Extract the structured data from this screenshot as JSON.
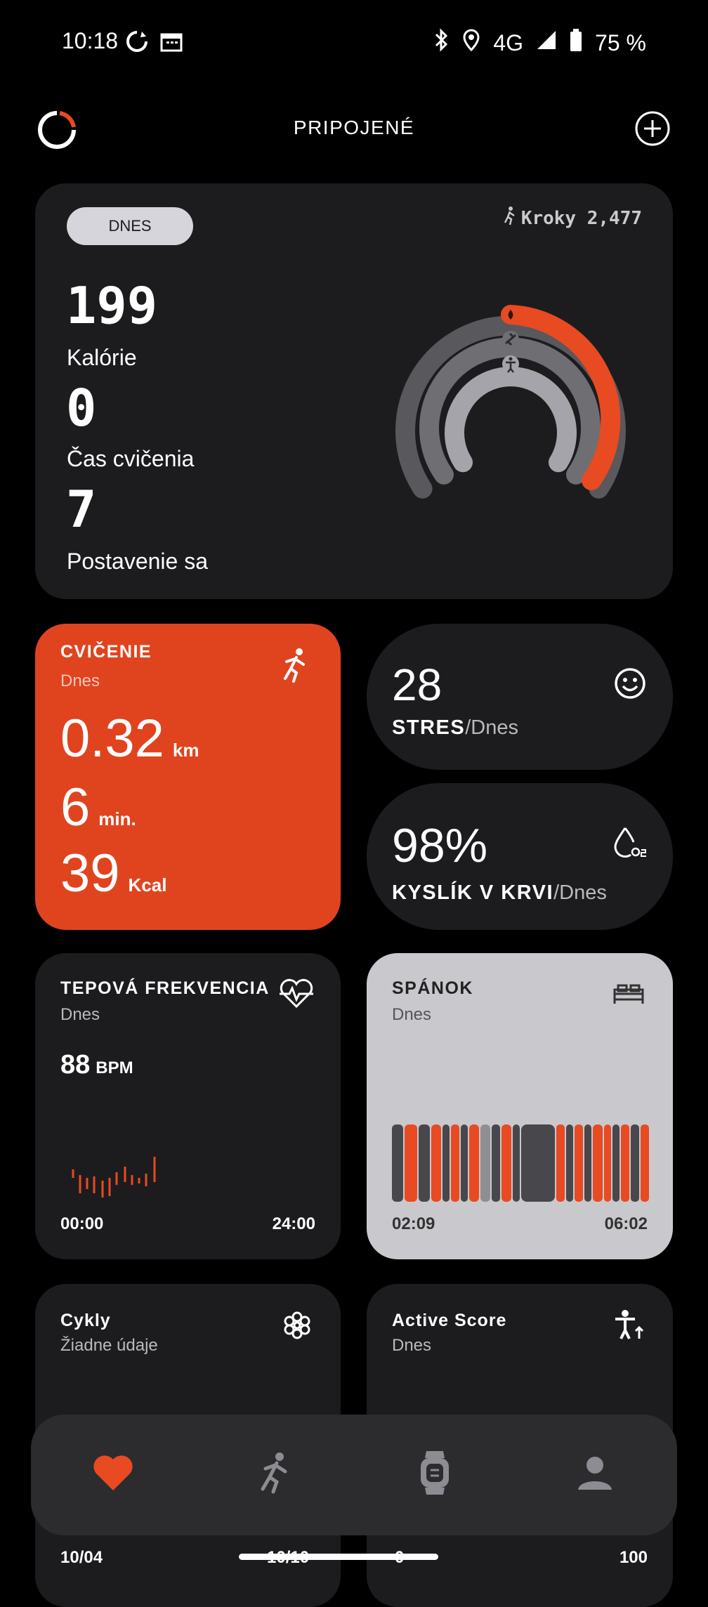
{
  "status_bar": {
    "time": "10:18",
    "network": "4G",
    "battery": "75 %",
    "icons": [
      "sync-icon",
      "calendar-icon",
      "bluetooth-icon",
      "location-icon",
      "signal-icon",
      "battery-icon"
    ]
  },
  "header": {
    "title": "PRIPOJENÉ"
  },
  "summary": {
    "tab": "DNES",
    "steps": "Kroky 2,477",
    "metrics": [
      {
        "value": "199",
        "label": "Kalórie"
      },
      {
        "value": "0",
        "label": "Čas cvičenia"
      },
      {
        "value": "7",
        "label": "Postavenie sa"
      }
    ],
    "rings": {
      "calories_fraction": 0.42,
      "exercise_fraction": 0.0,
      "stand_fraction": 0.0,
      "colors": {
        "accent": "#e84a22",
        "track_outer": "#59585d",
        "track_mid": "#6f6e73",
        "track_inner": "#a5a4aa"
      }
    }
  },
  "exercise": {
    "title": "CVIČENIE",
    "subtitle": "Dnes",
    "distance_value": "0.32",
    "distance_unit": "km",
    "time_value": "6",
    "time_unit": "min.",
    "kcal_value": "39",
    "kcal_unit": "Kcal",
    "color": "#e0441f"
  },
  "stress": {
    "value": "28",
    "label": "STRES",
    "suffix": "/Dnes"
  },
  "oxygen": {
    "value": "98%",
    "label": "KYSLÍK V KRVI",
    "suffix": "/Dnes"
  },
  "heart": {
    "title": "TEPOVÁ FREKVENCIA",
    "subtitle": "Dnes",
    "value": "88",
    "unit": "BPM",
    "start": "00:00",
    "end": "24:00"
  },
  "sleep": {
    "title": "SPÁNOK",
    "subtitle": "Dnes",
    "start": "02:09",
    "end": "06:02"
  },
  "cycles": {
    "title": "Cykly",
    "subtitle": "Žiadne údaje",
    "footer": "10/04"
  },
  "active_score": {
    "title": "Active Score",
    "subtitle": "Dnes",
    "footer_mid": "0",
    "footer_right": "100"
  },
  "cycles_footer_mid": "10/10",
  "bottom_nav": {
    "items": [
      "heart-icon",
      "running-icon",
      "watch-icon",
      "profile-icon"
    ]
  }
}
